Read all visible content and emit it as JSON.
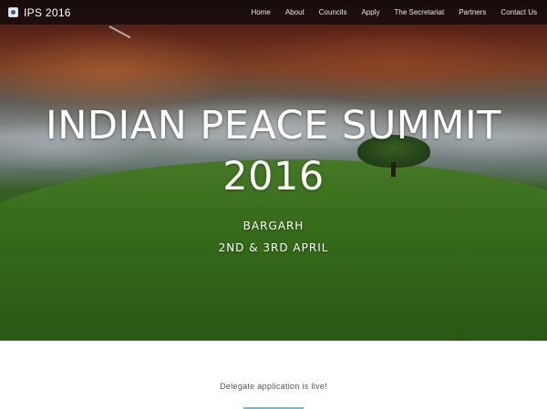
{
  "nav": {
    "brand": "IPS 2016",
    "links": [
      "Home",
      "About",
      "Councils",
      "Apply",
      "The Secretariat",
      "Partners",
      "Contact Us"
    ]
  },
  "hero": {
    "title_line1": "INDIAN PEACE SUMMIT",
    "title_line2": "2016",
    "location": "BARGARH",
    "dates": "2ND & 3RD APRIL"
  },
  "announcement": {
    "text": "Delegate application is live!"
  },
  "colors": {
    "accent": "#5fc3d8",
    "navbar": "#140c0a"
  }
}
